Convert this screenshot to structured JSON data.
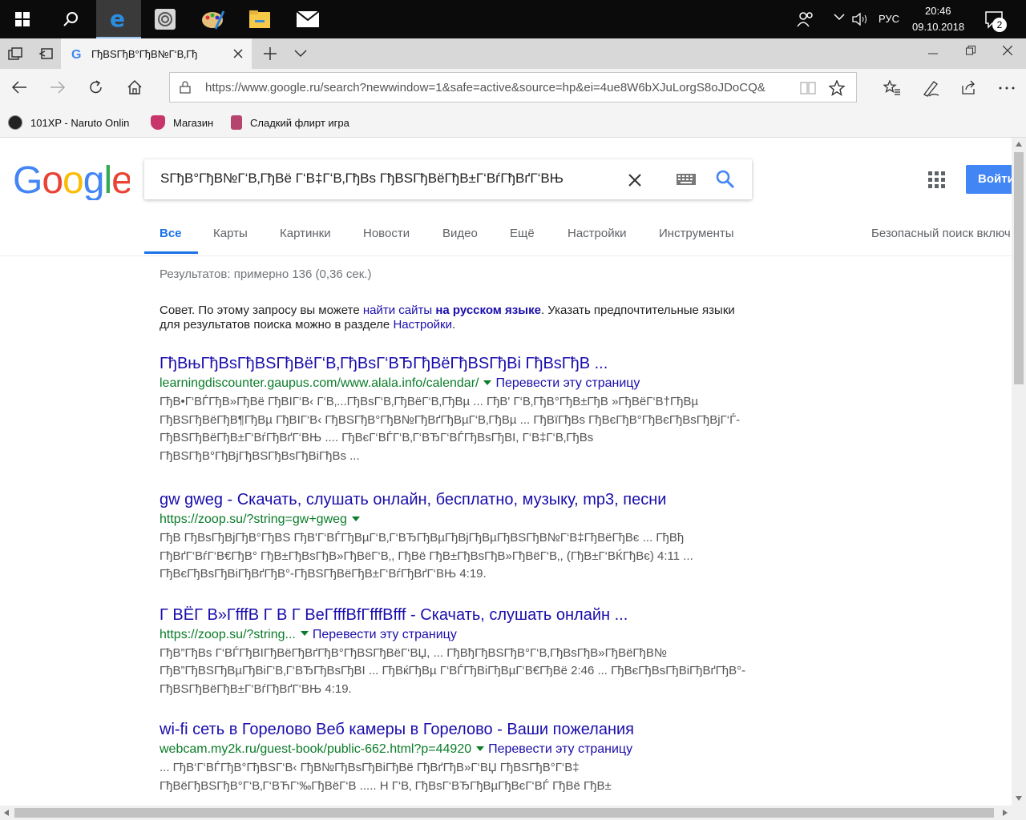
{
  "taskbar": {
    "icons": [
      "windows-start-icon",
      "search-icon",
      "edge-icon",
      "app-icon",
      "paint-icon",
      "file-explorer-icon",
      "mail-icon"
    ],
    "lang": "РУС",
    "time": "20:46",
    "date": "09.10.2018",
    "notifications": "2"
  },
  "browser": {
    "tab_title": "ГђВЅГђВ°ГђВ№Г‘В‚Гђ",
    "url": "https://www.google.ru/search?newwindow=1&safe=active&source=hp&ei=4ue8W6bXJuLorgS8oJDoCQ&",
    "favorites": [
      {
        "label": "101XP - Naruto Onlin",
        "icon_color": "#222"
      },
      {
        "label": "Магазин",
        "icon_color": "#c8356b"
      },
      {
        "label": "Сладкий флирт  игра",
        "icon_color": "#b5446e"
      }
    ]
  },
  "google": {
    "query": "SГђВ°ГђВ№Г‘В‚ГђВё Г‘В‡Г‘В‚ГђВѕ ГђВЅГђВёГђВ±Г‘ВѓГђВґГ‘ВЊ",
    "signin": "Войти",
    "tabs": [
      "Все",
      "Карты",
      "Картинки",
      "Новости",
      "Видео",
      "Ещё",
      "Настройки",
      "Инструменты"
    ],
    "safe_search": "Безопасный поиск включ",
    "result_stats": "Результатов: примерно 136 (0,36 сек.)",
    "tip": {
      "prefix": "Совет. По этому запросу вы можете ",
      "link1": "найти сайты",
      "link2": "на русском языке",
      "middle": ". Указать предпочтительные языки для результатов поиска можно в разделе ",
      "link3": "Настройки",
      "suffix": "."
    },
    "results": [
      {
        "title": "ГђВњГђВѕГђВЅГђВёГ‘В‚ГђВѕГ‘ВЂГђВёГђВЅГђВі ГђВѕГђВ ...",
        "url": "learningdiscounter.gaupus.com/www.alala.info/calendar/",
        "translate": "Перевести эту страницу",
        "snippet": "ГђВ•Г‘ВЃГђВ»ГђВё ГђВІГ‘В‹ Г‘В‚...ГђВѕГ‘В‚ГђВёГ‘В‚ГђВµ ... ГђВ' Г‘В‚ГђВ°ГђВ±ГђВ »ГђВёГ‘В†ГђВµ ГђВЅГђВёГђВ¶ГђВµ ГђВІГ‘В‹ ГђВЅГђВ°ГђВ№ГђВґГђВµГ‘В‚ГђВµ ... ГђВїГђВѕ ГђВєГђВ°ГђВєГђВѕГђВјГ‘Ѓ-ГђВЅГђВёГђВ±Г‘ВѓГђВґГ‘ВЊ .... ГђВєГ‘ВЃГ‘В‚Г‘ВЂГ‘ВЃГђВѕГђВІ, Г‘В‡Г‘В‚ГђВѕ ГђВЅГђВ°ГђВјГђВЅГђВѕГђВіГђВѕ ..."
      },
      {
        "title": "gw gweg - Скачать, слушать онлайн, бесплатно, музыку, mp3, песни",
        "url": "https://zoop.su/?string=gw+gweg",
        "translate": "",
        "snippet": "ГђВ ГђВѕГђВјГђВ°ГђВЅ ГђВ'Г‘ВЃГђВµГ‘В‚Г‘ВЂГђВµГђВјГђВµГђВЅГђВ№Г‘В‡ГђВёГђВє ... ГђВђ ГђВґГ‘ВѓГ‘В€ГђВ° ГђВ±ГђВѕГђВ»ГђВёГ‘В‚, ГђВё ГђВ±ГђВѕГђВ»ГђВёГ‘В‚, (ГђВ±Г‘ВЌГђВє) 4:11 ... ГђВєГђВѕГђВіГђВґГђВ°-ГђВЅГђВёГђВ±Г‘ВѓГђВґГ‘ВЊ 4:19."
      },
      {
        "title": "Г ВЁГ В»ГfffВ Г В Г ВеГfffВfГfffВfff - Скачать, слушать онлайн ...",
        "url": "https://zoop.su/?string...",
        "translate": "Перевести эту страницу",
        "snippet": "ГђВ”ГђВѕ Г‘ВЃГђВІГђВёГђВґГђВ°ГђВЅГђВёГ‘ВЏ, ... ГђВђГђВЅГђВ°Г‘В‚ГђВѕГђВ»ГђВёГђВ№ ГђВ”ГђВЅГђВµГђВіГ‘В‚Г‘ВЂГђВѕГђВІ ... ГђВќГђВµ Г‘ВЃГђВіГђВµГ‘В€ГђВё 2:46 ... ГђВєГђВѕГђВіГђВґГђВ°-ГђВЅГђВёГђВ±Г‘ВѓГђВґГ‘ВЊ 4:19."
      },
      {
        "title": "wi-fi сеть в Горелово Веб камеры в Горелово - Ваши пожелания",
        "url": "webcam.my2k.ru/guest-book/public-662.html?p=44920",
        "translate": "Перевести эту страницу",
        "snippet": "... ГђВ‘Г‘ВЃГђВ°ГђВЅГ‘В‹ ГђВ№ГђВѕГђВіГђВё ГђВґГђВ»Г‘ВЏ ГђВЅГђВ°Г‘В‡ ГђВёГђВЅГђВ°Г‘В‚Г‘ВЋГ‘‰ГђВёГ‘В ..... Н Г‘В‚ ГђВѕГ‘ВЂГђВµГђВєГ‘ВЃ ГђВё ГђВ±"
      }
    ]
  }
}
